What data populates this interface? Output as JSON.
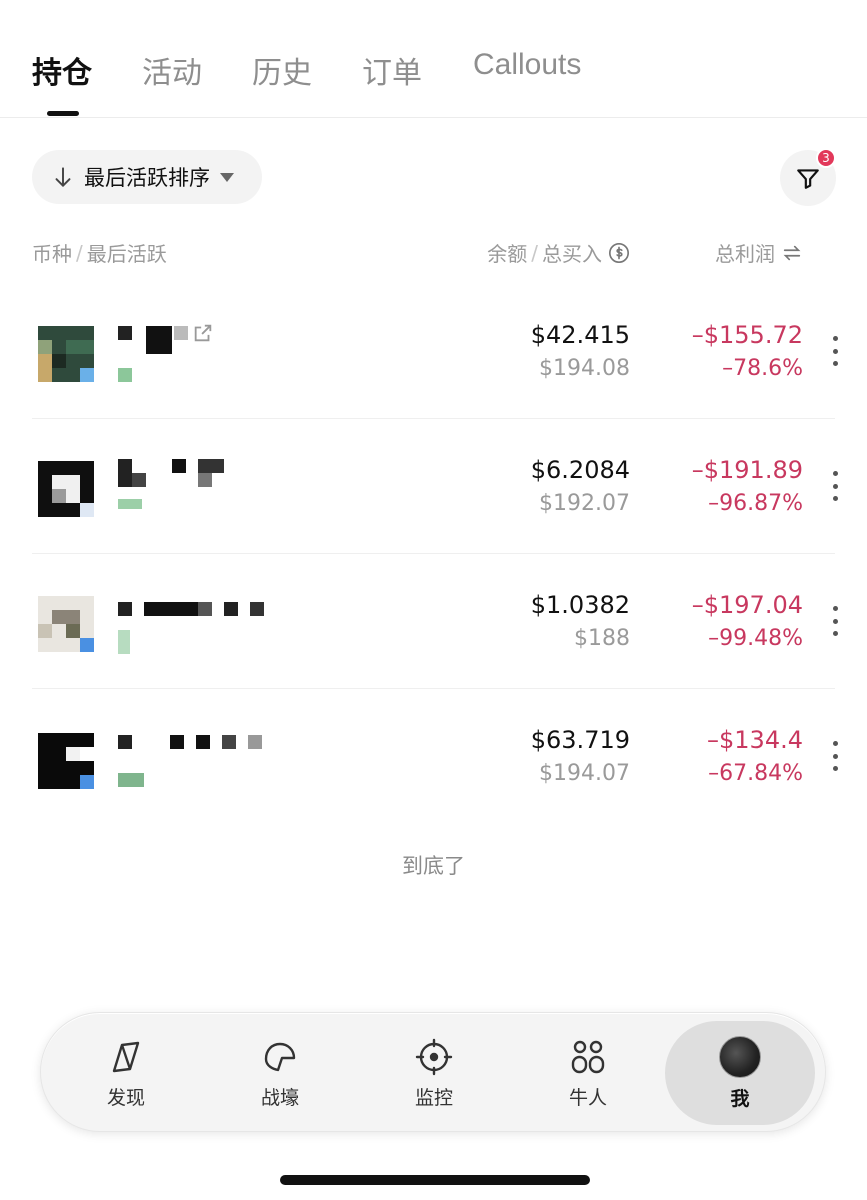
{
  "tabs": [
    {
      "label": "持仓",
      "active": true
    },
    {
      "label": "活动"
    },
    {
      "label": "历史"
    },
    {
      "label": "订单"
    },
    {
      "label": "Callouts"
    }
  ],
  "sort": {
    "label": "最后活跃排序",
    "icon": "arrow-down-icon"
  },
  "filter": {
    "badge": "3",
    "icon": "filter-icon"
  },
  "columns": {
    "token": "币种",
    "last_active": "最后活跃",
    "balance": "余额",
    "total_buy": "总买入",
    "pnl": "总利润",
    "separator": "/"
  },
  "positions": [
    {
      "balance": "$42.415",
      "total_buy": "$194.08",
      "pnl": "–$155.72",
      "pct": "–78.6%"
    },
    {
      "balance": "$6.2084",
      "total_buy": "$192.07",
      "pnl": "–$191.89",
      "pct": "–96.87%"
    },
    {
      "balance": "$1.0382",
      "total_buy": "$188",
      "pnl": "–$197.04",
      "pct": "–99.48%"
    },
    {
      "balance": "$63.719",
      "total_buy": "$194.07",
      "pnl": "–$134.4",
      "pct": "–67.84%"
    }
  ],
  "end_text": "到底了",
  "nav": [
    {
      "label": "发现",
      "icon": "compass-icon"
    },
    {
      "label": "战壕",
      "icon": "helmet-icon"
    },
    {
      "label": "监控",
      "icon": "crosshair-icon"
    },
    {
      "label": "牛人",
      "icon": "grid-people-icon"
    },
    {
      "label": "我",
      "icon": "avatar",
      "active": true
    }
  ],
  "colors": {
    "loss": "#c8385f",
    "badge": "#e2385a"
  }
}
